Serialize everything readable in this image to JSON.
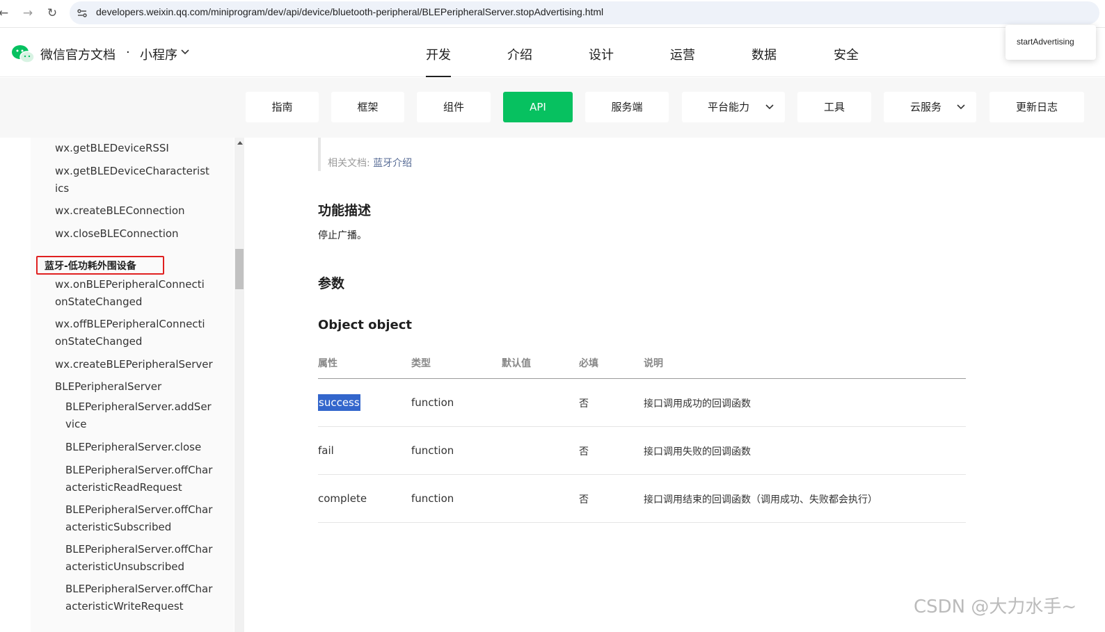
{
  "browser": {
    "url": "developers.weixin.qq.com/miniprogram/dev/api/device/bluetooth-peripheral/BLEPeripheralServer.stopAdvertising.html",
    "back_icon": "arrow-left-icon",
    "forward_icon": "arrow-right-icon",
    "reload_icon": "reload-icon"
  },
  "header": {
    "brand": "微信官方文档",
    "dot": "·",
    "product": "小程序",
    "nav": [
      "开发",
      "介绍",
      "设计",
      "运营",
      "数据",
      "安全"
    ],
    "active_nav": "开发",
    "tooltip": "startAdvertising"
  },
  "subnav": {
    "tabs": [
      "指南",
      "框架",
      "组件",
      "API",
      "服务端",
      "平台能力",
      "工具",
      "云服务",
      "更新日志"
    ],
    "active": "API",
    "accent_color": "#07c160"
  },
  "sidebar": {
    "items_top": [
      "wx.getBLEDeviceRSSI",
      "wx.getBLEDeviceCharacteristics",
      "wx.createBLEConnection",
      "wx.closeBLEConnection"
    ],
    "group": "蓝牙-低功耗外围设备",
    "items_group": [
      "wx.onBLEPeripheralConnectionStateChanged",
      "wx.offBLEPeripheralConnectionStateChanged",
      "wx.createBLEPeripheralServer",
      "BLEPeripheralServer"
    ],
    "items_sub": [
      "BLEPeripheralServer.addService",
      "BLEPeripheralServer.close",
      "BLEPeripheralServer.offCharacteristicReadRequest",
      "BLEPeripheralServer.offCharacteristicSubscribed",
      "BLEPeripheralServer.offCharacteristicUnsubscribed",
      "BLEPeripheralServer.offCharacteristicWriteRequest"
    ]
  },
  "content": {
    "related_label": "相关文档: ",
    "related_link": "蓝牙介绍",
    "section_desc": "功能描述",
    "desc_text": "停止广播。",
    "section_params": "参数",
    "object_title": "Object object",
    "table": {
      "headers": [
        "属性",
        "类型",
        "默认值",
        "必填",
        "说明"
      ],
      "rows": [
        {
          "name": "success",
          "type": "function",
          "default": "",
          "required": "否",
          "desc": "接口调用成功的回调函数"
        },
        {
          "name": "fail",
          "type": "function",
          "default": "",
          "required": "否",
          "desc": "接口调用失败的回调函数"
        },
        {
          "name": "complete",
          "type": "function",
          "default": "",
          "required": "否",
          "desc": "接口调用结束的回调函数（调用成功、失败都会执行）"
        }
      ]
    }
  },
  "watermark": "CSDN @大力水手~"
}
